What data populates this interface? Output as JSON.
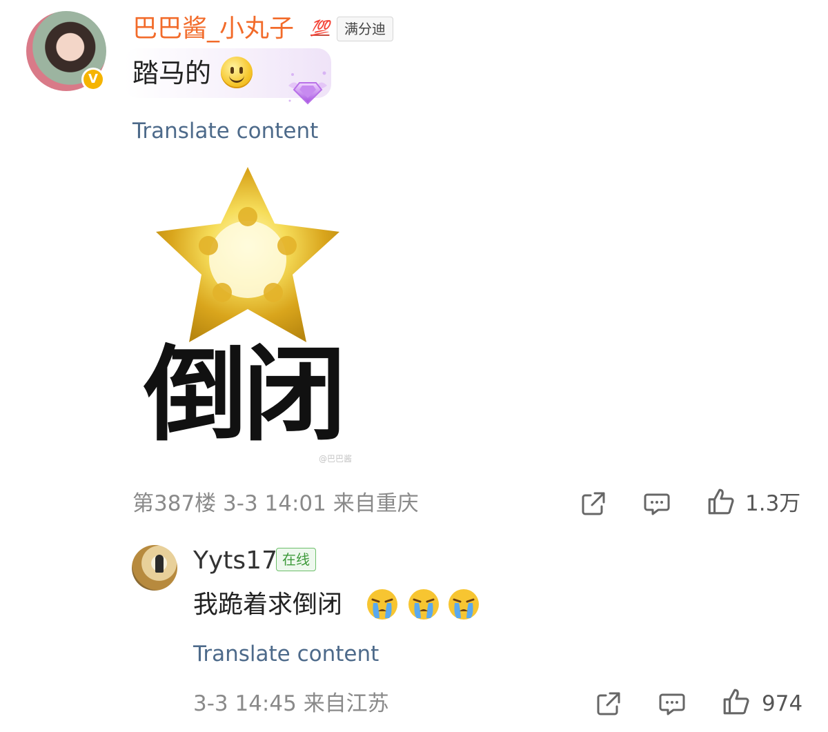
{
  "main_comment": {
    "username": "巴巴酱_小丸子",
    "fan_badge_icon": "💯",
    "fan_badge": "满分迪",
    "verified_badge": "V",
    "text": "踏马的",
    "emoji": "smiley-icon",
    "translate": "Translate content",
    "sticker_text": "倒闭",
    "sticker_watermark": "@巴巴酱",
    "floor": "第387楼",
    "time": "3-3 14:01",
    "location": "来自重庆",
    "likes": "1.3万"
  },
  "reply": {
    "username": "Yyts17",
    "status_badge": "在线",
    "text": "我跪着求倒闭",
    "emojis": [
      "crying-face-icon",
      "crying-face-icon",
      "crying-face-icon"
    ],
    "translate": "Translate content",
    "time": "3-3 14:45",
    "location": "来自江苏",
    "likes": "974"
  },
  "colors": {
    "username_main": "#f26b2a",
    "translate_link": "#4d6a8a",
    "meta_text": "#8a8a8a",
    "online_badge": "#3e9a3b",
    "star_gold": "#e8b923"
  }
}
